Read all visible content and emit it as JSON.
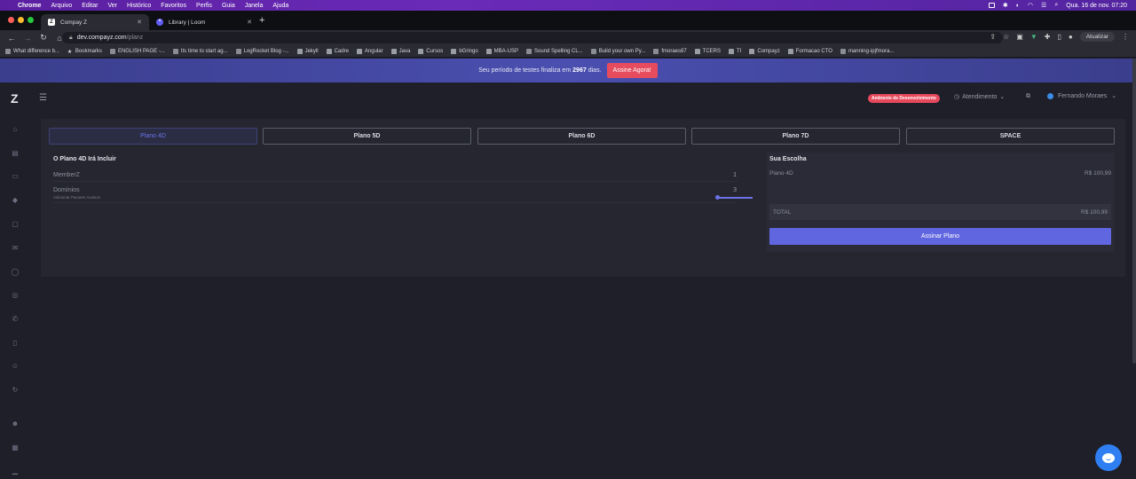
{
  "menubar": {
    "apple": "",
    "items": [
      "Chrome",
      "Arquivo",
      "Editar",
      "Ver",
      "Histórico",
      "Favoritos",
      "Perfis",
      "Guia",
      "Janela",
      "Ajuda"
    ],
    "datetime": "Qua. 16 de nov. 07:20"
  },
  "tabs": [
    {
      "label": "Compay Z",
      "favicon": "Z"
    },
    {
      "label": "Library | Loom",
      "favicon": "*"
    }
  ],
  "address": {
    "host": "dev.compayz.com",
    "path": "/planz",
    "update_label": "Atualizar"
  },
  "bookmarks": [
    {
      "label": "What difference b...",
      "icon": "page"
    },
    {
      "label": "Bookmarks",
      "icon": "star"
    },
    {
      "label": "ENGLISH PAGE -...",
      "icon": "page"
    },
    {
      "label": "Its time to start ag...",
      "icon": "page"
    },
    {
      "label": "LogRocket Blog -...",
      "icon": "page"
    },
    {
      "label": "Jekyll",
      "icon": "folder"
    },
    {
      "label": "Cadre",
      "icon": "folder"
    },
    {
      "label": "Angular",
      "icon": "folder"
    },
    {
      "label": "Java",
      "icon": "folder"
    },
    {
      "label": "Cursos",
      "icon": "folder"
    },
    {
      "label": "bGringo",
      "icon": "folder"
    },
    {
      "label": "MBA-USP",
      "icon": "folder"
    },
    {
      "label": "Sound Spelling CL...",
      "icon": "page"
    },
    {
      "label": "Build your own Py...",
      "icon": "page"
    },
    {
      "label": "fmoraes87",
      "icon": "page"
    },
    {
      "label": "TCERS",
      "icon": "folder"
    },
    {
      "label": "TI",
      "icon": "folder"
    },
    {
      "label": "Compayz",
      "icon": "folder"
    },
    {
      "label": "Formacao CTO",
      "icon": "folder"
    },
    {
      "label": "manning-ipjfmora...",
      "icon": "page"
    }
  ],
  "banner": {
    "text_before": "Seu período de testes finaliza em",
    "days": "2967",
    "text_after": "dias.",
    "cta": "Assine Agora!"
  },
  "header": {
    "logo": "Z",
    "env_badge": "Ambiente de Desenvolvimento",
    "support_label": "Atendimento",
    "user_name": "Fernando Moraes"
  },
  "plans": {
    "tabs": [
      "Plano 4D",
      "Plano 5D",
      "Plano 6D",
      "Plano 7D",
      "SPACE"
    ],
    "active_index": 0
  },
  "includes": {
    "title": "O Plano 4D Irá Incluir",
    "rows": [
      {
        "label": "MemberZ",
        "value": "1"
      },
      {
        "label": "Domínios",
        "value": "3",
        "sub": "Adicionar Pacotes Avulsos"
      }
    ],
    "slider_level": 1.0
  },
  "summary": {
    "title": "Sua Escolha",
    "plan_label": "Plano 4D",
    "plan_price": "R$ 100,99",
    "total_label": "TOTAL",
    "total_price": "R$ 100,99",
    "button": "Assinar Plano"
  },
  "colors": {
    "accent": "#6066e0",
    "banner": "#4a4fb0",
    "cta": "#e74c5e",
    "env_badge": "#e7495c",
    "chat": "#2f7ff2"
  }
}
